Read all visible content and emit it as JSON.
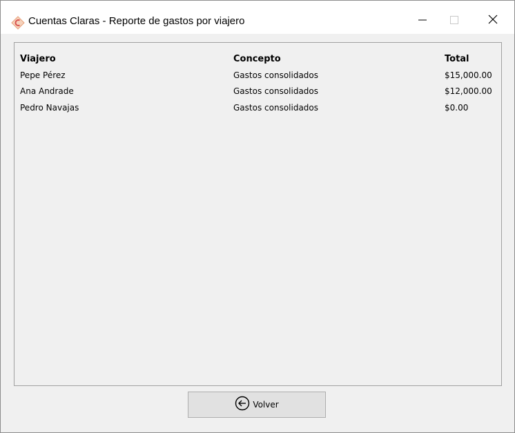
{
  "window": {
    "title": "Cuentas Claras - Reporte de gastos por viajero",
    "icons": {
      "app": "cuentas-claras-logo-icon",
      "minimize": "minimize-icon",
      "maximize": "maximize-icon",
      "close": "close-icon"
    }
  },
  "report": {
    "headers": {
      "viajero": "Viajero",
      "concepto": "Concepto",
      "total": "Total"
    },
    "rows": [
      {
        "viajero": "Pepe Pérez",
        "concepto": "Gastos consolidados",
        "total": "$15,000.00"
      },
      {
        "viajero": "Ana Andrade",
        "concepto": "Gastos consolidados",
        "total": "$12,000.00"
      },
      {
        "viajero": "Pedro Navajas",
        "concepto": "Gastos consolidados",
        "total": "$0.00"
      }
    ]
  },
  "actions": {
    "volver_label": "Volver",
    "volver_icon": "arrow-left-circle-icon"
  }
}
